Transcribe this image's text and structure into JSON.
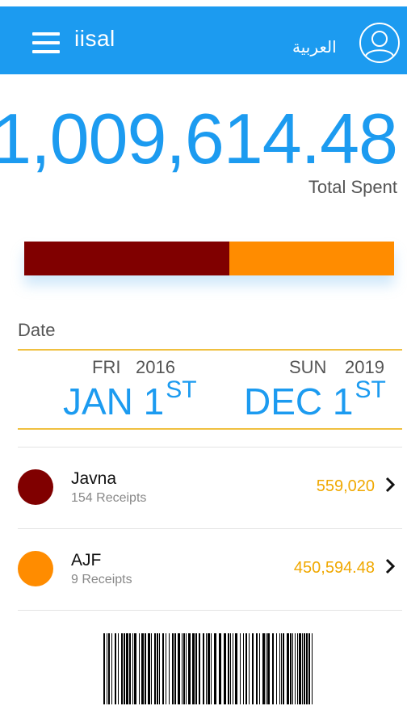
{
  "header": {
    "title": "iisal",
    "language_label": "العربية",
    "menu_icon": "hamburger-menu-icon",
    "avatar_icon": "user-avatar-icon"
  },
  "summary": {
    "total_amount": "1,009,614.48",
    "total_label": "Total Spent"
  },
  "breakdown_bar": {
    "segments": [
      {
        "name": "Javna",
        "value": 559020,
        "color": "#800000"
      },
      {
        "name": "AJF",
        "value": 450594.48,
        "color": "#ff8c00"
      }
    ]
  },
  "date_range": {
    "label": "Date",
    "start": {
      "weekday": "FRI",
      "year": "2016",
      "month_day": "JAN 1",
      "suffix": "ST"
    },
    "end": {
      "weekday": "SUN",
      "year": "2019",
      "month_day": "DEC 1",
      "suffix": "ST"
    }
  },
  "merchants": [
    {
      "name": "Javna",
      "receipts": "154 Receipts",
      "amount": "559,020",
      "color": "#800000"
    },
    {
      "name": "AJF",
      "receipts": "9 Receipts",
      "amount": "450,594.48",
      "color": "#ff8c00"
    }
  ],
  "colors": {
    "accent": "#1c9bf0",
    "amount": "#f0a800",
    "divider": "#f0c040"
  }
}
